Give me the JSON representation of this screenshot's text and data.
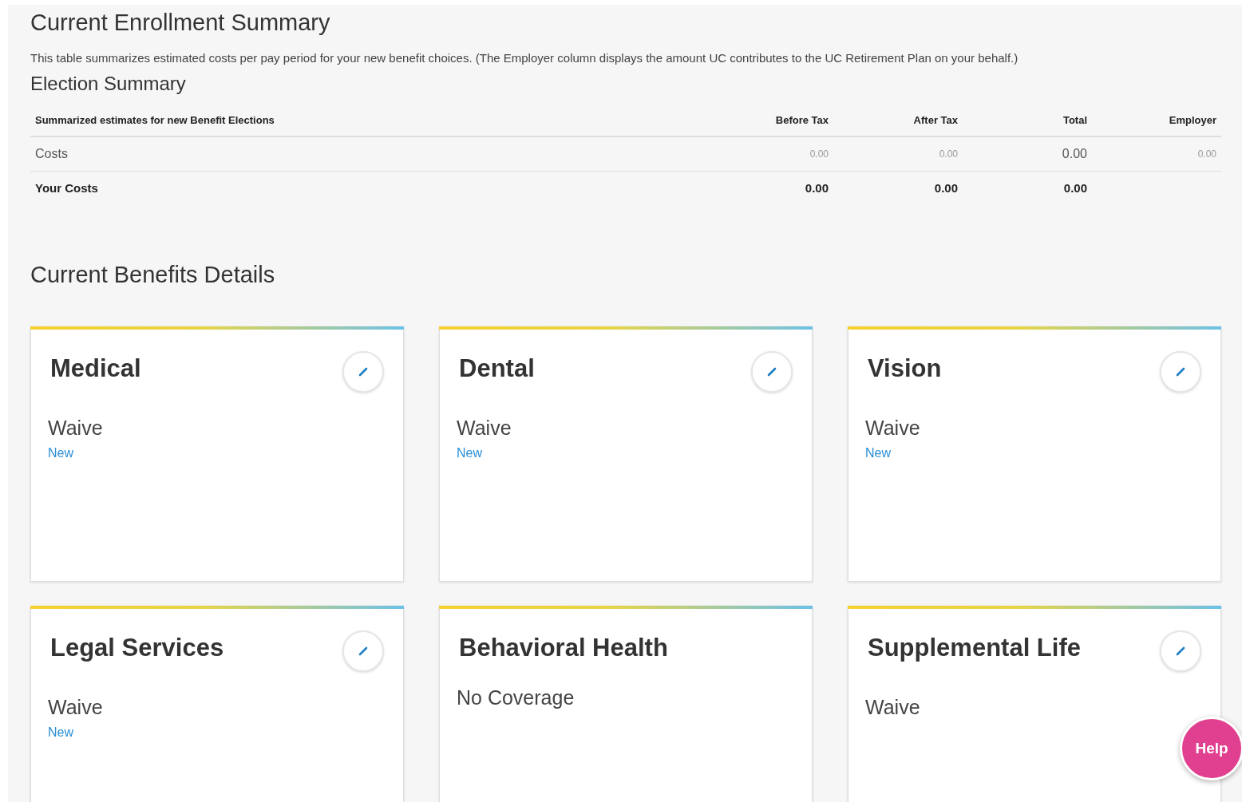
{
  "title": "Current Enrollment Summary",
  "description": "This table summarizes estimated costs per pay period for your new benefit choices. (The Employer column displays the amount UC contributes to the UC Retirement Plan on your behalf.)",
  "election_summary": {
    "title": "Election Summary",
    "columns": [
      "Summarized estimates for new Benefit Elections",
      "Before Tax",
      "After Tax",
      "Total",
      "Employer"
    ],
    "rows": [
      {
        "kind": "detail",
        "cells": [
          "Costs",
          "0.00",
          "0.00",
          "0.00",
          "0.00"
        ]
      },
      {
        "kind": "total",
        "cells": [
          "Your Costs",
          "0.00",
          "0.00",
          "0.00"
        ]
      }
    ]
  },
  "benefits_title": "Current Benefits Details",
  "cards": [
    {
      "title": "Medical",
      "status": "Waive",
      "tag": "New",
      "editable": true
    },
    {
      "title": "Dental",
      "status": "Waive",
      "tag": "New",
      "editable": true
    },
    {
      "title": "Vision",
      "status": "Waive",
      "tag": "New",
      "editable": true
    },
    {
      "title": "Legal Services",
      "status": "Waive",
      "tag": "New",
      "editable": true
    },
    {
      "title": "Behavioral Health",
      "status": "No Coverage",
      "editable": false
    },
    {
      "title": "Supplemental Life",
      "status": "Waive",
      "editable": true
    }
  ],
  "help_button": "Help"
}
